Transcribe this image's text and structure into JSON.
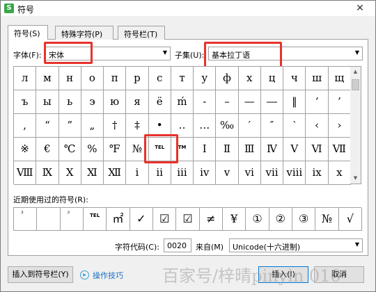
{
  "window": {
    "app_icon": "S",
    "title": "符号",
    "close_glyph": "✕"
  },
  "tabs": [
    {
      "label": "符号(S)"
    },
    {
      "label": "特殊字符(P)"
    },
    {
      "label": "符号栏(T)"
    }
  ],
  "font": {
    "label": "字体(F):",
    "value": "宋体"
  },
  "subset": {
    "label": "子集(U):",
    "value": "基本拉丁语"
  },
  "symbol_grid": [
    [
      "л",
      "м",
      "н",
      "о",
      "п",
      "р",
      "с",
      "т",
      "у",
      "ф",
      "х",
      "ц",
      "ч",
      "ш",
      "щ"
    ],
    [
      "ъ",
      "ы",
      "ь",
      "э",
      "ю",
      "я",
      "ё",
      "ḿ",
      "-",
      "–",
      "—",
      "―",
      "‖",
      "‘",
      "’"
    ],
    [
      ",",
      "“",
      "”",
      "„",
      "†",
      "‡",
      "•",
      "‥",
      "…",
      "‰",
      "′",
      "″",
      "‵",
      "‹",
      "›"
    ],
    [
      "※",
      "€",
      "℃",
      "%",
      "℉",
      "№",
      "TEL",
      "TM",
      "Ⅰ",
      "Ⅱ",
      "Ⅲ",
      "Ⅳ",
      "Ⅴ",
      "Ⅵ",
      "Ⅶ"
    ],
    [
      "Ⅷ",
      "Ⅸ",
      "Ⅹ",
      "Ⅺ",
      "Ⅻ",
      "ⅰ",
      "ⅱ",
      "ⅲ",
      "ⅳ",
      "ⅴ",
      "ⅵ",
      "ⅶ",
      "ⅷ",
      "ⅸ",
      "ⅹ"
    ]
  ],
  "recent": {
    "label": "近期使用过的符号(R):",
    "symbols": [
      "³",
      "",
      "²",
      "TEL",
      "㎡",
      "✓",
      "☑",
      "☑",
      "≠",
      "¥",
      "①",
      "②",
      "③",
      "№",
      "√"
    ]
  },
  "char_code": {
    "label": "字符代码(C):",
    "value": "0020"
  },
  "from": {
    "label": "来自(M)",
    "value": "Unicode(十六进制)"
  },
  "buttons": {
    "insert_to_bar": "插入到符号栏(Y)",
    "tips": "操作技巧",
    "insert": "插入(I)",
    "cancel": "取消"
  },
  "watermark": "百家号/梓晴pinyin 010"
}
